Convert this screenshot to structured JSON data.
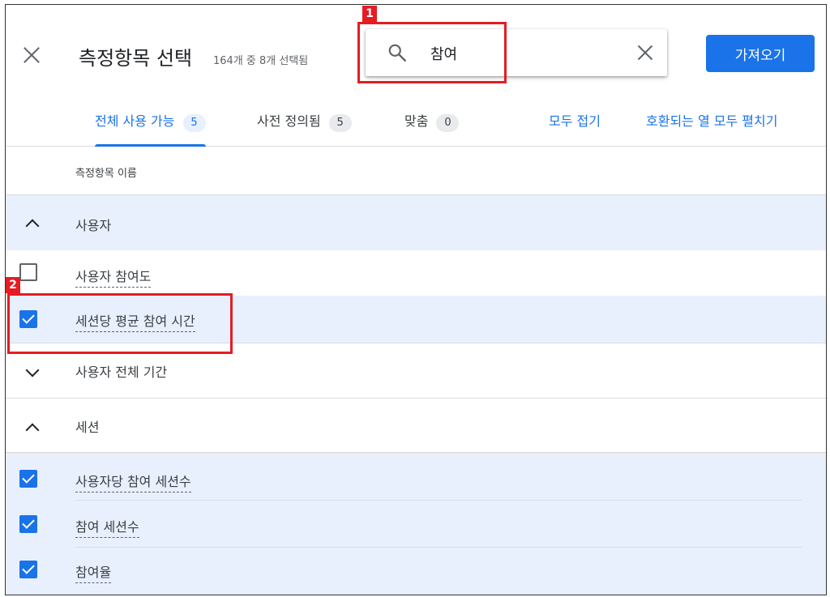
{
  "header": {
    "title": "측정항목 선택",
    "subtitle": "164개 중 8개 선택됨",
    "import_label": "가져오기"
  },
  "search": {
    "value": "참여"
  },
  "callouts": [
    "1",
    "2"
  ],
  "tabs": [
    {
      "label": "전체 사용 가능",
      "count": "5"
    },
    {
      "label": "사전 정의됨",
      "count": "5"
    },
    {
      "label": "맞춤",
      "count": "0"
    }
  ],
  "links": {
    "collapse_all": "모두 접기",
    "expand_all": "호환되는 열 모두 펼치기"
  },
  "column_header": "측정항목 이름",
  "groups": {
    "user": {
      "label": "사용자",
      "expanded": true
    },
    "user_lifetime": {
      "label": "사용자 전체 기간",
      "expanded": false
    },
    "session": {
      "label": "세션",
      "expanded": true
    }
  },
  "items": [
    {
      "label": "사용자 참여도",
      "checked": false
    },
    {
      "label": "세션당 평균 참여 시간",
      "checked": true
    },
    {
      "label": "사용자당 참여 세션수",
      "checked": true
    },
    {
      "label": "참여 세션수",
      "checked": true
    },
    {
      "label": "참여율",
      "checked": true
    }
  ],
  "colors": {
    "accent": "#1a73e8",
    "callout": "#e51c23",
    "selected_bg": "#e8f0fe"
  }
}
